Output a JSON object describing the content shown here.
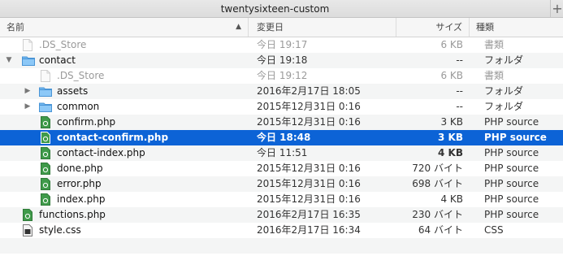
{
  "window": {
    "title": "twentysixteen-custom",
    "new_tab": "+"
  },
  "columns": {
    "name": "名前",
    "date": "変更日",
    "size": "サイズ",
    "kind": "種類"
  },
  "rows": [
    {
      "name": ".DS_Store",
      "date": "今日 19:17",
      "size": "6 KB",
      "kind": "書類"
    },
    {
      "name": "contact",
      "date": "今日 19:18",
      "size": "--",
      "kind": "フォルダ"
    },
    {
      "name": ".DS_Store",
      "date": "今日 19:12",
      "size": "6 KB",
      "kind": "書類"
    },
    {
      "name": "assets",
      "date": "2016年2月17日 18:05",
      "size": "--",
      "kind": "フォルダ"
    },
    {
      "name": "common",
      "date": "2015年12月31日 0:16",
      "size": "--",
      "kind": "フォルダ"
    },
    {
      "name": "confirm.php",
      "date": "2015年12月31日 0:16",
      "size": "3 KB",
      "kind": "PHP source"
    },
    {
      "name": "contact-confirm.php",
      "date": "今日 18:48",
      "size": "3 KB",
      "kind": "PHP source"
    },
    {
      "name": "contact-index.php",
      "date": "今日 11:51",
      "size": "4 KB",
      "kind": "PHP source"
    },
    {
      "name": "done.php",
      "date": "2015年12月31日 0:16",
      "size": "720 バイト",
      "kind": "PHP source"
    },
    {
      "name": "error.php",
      "date": "2015年12月31日 0:16",
      "size": "698 バイト",
      "kind": "PHP source"
    },
    {
      "name": "index.php",
      "date": "2015年12月31日 0:16",
      "size": "4 KB",
      "kind": "PHP source"
    },
    {
      "name": "functions.php",
      "date": "2016年2月17日 16:35",
      "size": "230 バイト",
      "kind": "PHP source"
    },
    {
      "name": "style.css",
      "date": "2016年2月17日 16:34",
      "size": "64 バイト",
      "kind": "CSS"
    }
  ],
  "colors": {
    "selection": "#0c63d6",
    "folder": "#6fb6f0",
    "php": "#3f9a4a"
  }
}
